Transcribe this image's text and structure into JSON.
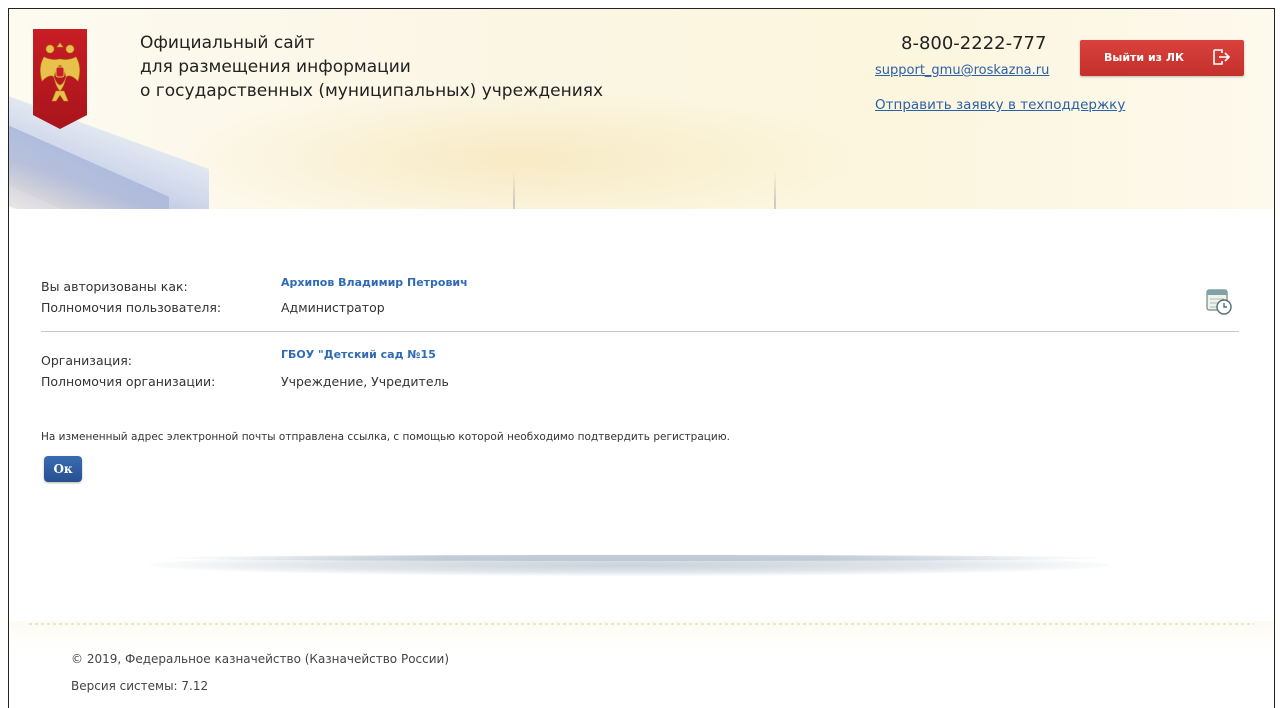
{
  "header": {
    "title_lines": [
      "Официальный сайт",
      "для размещения информации",
      "о государственных (муниципальных) учреждениях"
    ],
    "phone": "8-800-2222-777",
    "support_email": "support_gmu@roskazna.ru",
    "support_ticket_link": "Отправить заявку в техподдержку",
    "logout_button": "Выйти из ЛК",
    "logout_icon": "logout-arrow-icon",
    "emblem": "coat-of-arms-icon"
  },
  "user": {
    "authorized_label": "Вы авторизованы как:",
    "authorized_value": "Архипов Владимир Петрович",
    "permissions_label": "Полномочия пользователя:",
    "permissions_value": "Администратор"
  },
  "organization": {
    "label": "Организация:",
    "value": "ГБОУ \"Детский сад №15",
    "permissions_label": "Полномочия организации:",
    "permissions_value": "Учреждение, Учредитель"
  },
  "calendar_icon": "calendar-clock-icon",
  "message": "На измененный адрес электронной почты отправлена ссылка, с помощью которой необходимо подтвердить регистрацию.",
  "ok_button": "Ок",
  "footer": {
    "copyright": "© 2019, Федеральное казначейство (Казначейство России)",
    "version": "Версия системы: 7.12"
  },
  "colors": {
    "link": "#2b61a8",
    "logout_button": "#c4302c",
    "ok_button": "#274f8f",
    "emblem_red": "#c81d25"
  }
}
